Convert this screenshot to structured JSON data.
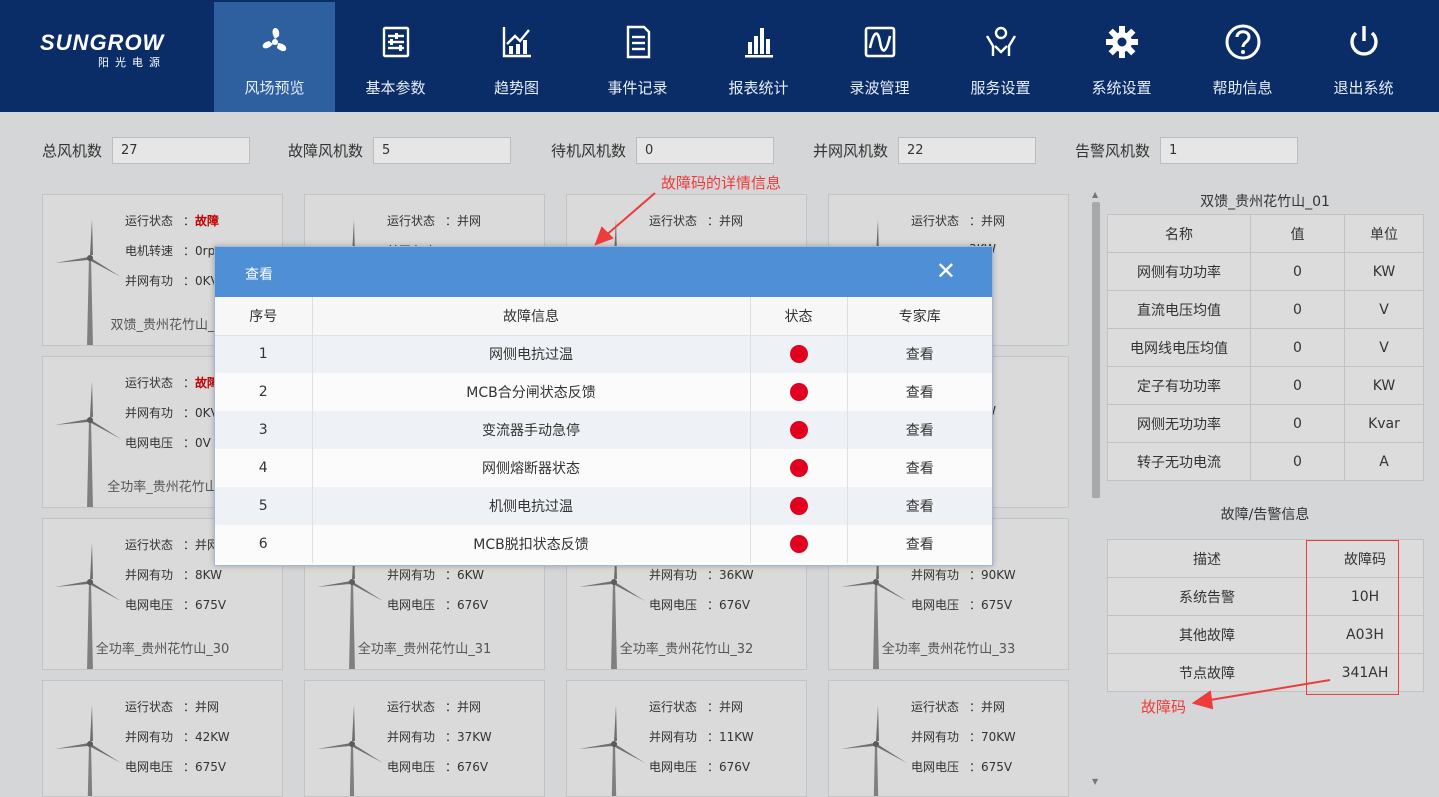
{
  "header": {
    "logo_brand": "SUNGROW",
    "logo_sub": "阳光电源",
    "nav": [
      {
        "label": "风场预览",
        "icon": "fan-icon",
        "active": true
      },
      {
        "label": "基本参数",
        "icon": "parameters-icon",
        "active": false
      },
      {
        "label": "趋势图",
        "icon": "trend-chart-icon",
        "active": false
      },
      {
        "label": "事件记录",
        "icon": "event-log-icon",
        "active": false
      },
      {
        "label": "报表统计",
        "icon": "report-bar-icon",
        "active": false
      },
      {
        "label": "录波管理",
        "icon": "waveform-icon",
        "active": false
      },
      {
        "label": "服务设置",
        "icon": "service-hands-icon",
        "active": false
      },
      {
        "label": "系统设置",
        "icon": "gear-icon",
        "active": false
      },
      {
        "label": "帮助信息",
        "icon": "help-icon",
        "active": false
      },
      {
        "label": "退出系统",
        "icon": "power-icon",
        "active": false
      }
    ]
  },
  "stats": [
    {
      "label": "总风机数",
      "value": "27"
    },
    {
      "label": "故障风机数",
      "value": "5"
    },
    {
      "label": "待机风机数",
      "value": "0"
    },
    {
      "label": "并网风机数",
      "value": "22"
    },
    {
      "label": "告警风机数",
      "value": "1"
    }
  ],
  "turbines": [
    {
      "rows": [
        {
          "k": "运行状态",
          "v": "故障",
          "fault": true
        },
        {
          "k": "电机转速",
          "v": "0rp"
        },
        {
          "k": "并网有功",
          "v": "0KV"
        }
      ],
      "name": "双馈_贵州花竹山_"
    },
    {
      "rows": [
        {
          "k": "运行状态",
          "v": "并网"
        },
        {
          "k": "并网有功",
          "v": ""
        },
        {
          "k": "",
          "v": ""
        }
      ],
      "name": ""
    },
    {
      "rows": [
        {
          "k": "运行状态",
          "v": "并网"
        },
        {
          "k": "",
          "v": ""
        },
        {
          "k": "",
          "v": ""
        }
      ],
      "name": ""
    },
    {
      "rows": [
        {
          "k": "运行状态",
          "v": "并网"
        },
        {
          "k": "",
          "v": "3KW"
        },
        {
          "k": "",
          "v": "76V"
        }
      ],
      "name": "山_25"
    },
    {
      "rows": [
        {
          "k": "运行状态",
          "v": "故障",
          "fault": true
        },
        {
          "k": "并网有功",
          "v": "0KV"
        },
        {
          "k": "电网电压",
          "v": "0V"
        }
      ],
      "name": "全功率_贵州花竹山"
    },
    {
      "rows": [],
      "name": ""
    },
    {
      "rows": [],
      "name": ""
    },
    {
      "rows": [
        {
          "k": "",
          "v": "网"
        },
        {
          "k": "",
          "v": "1KW"
        },
        {
          "k": "",
          "v": "75V"
        }
      ],
      "name": "山_29"
    },
    {
      "rows": [
        {
          "k": "运行状态",
          "v": "并网"
        },
        {
          "k": "并网有功",
          "v": "8KW"
        },
        {
          "k": "电网电压",
          "v": "675V"
        }
      ],
      "name": "全功率_贵州花竹山_30"
    },
    {
      "rows": [
        {
          "k": "",
          "v": ""
        },
        {
          "k": "并网有功",
          "v": "6KW"
        },
        {
          "k": "电网电压",
          "v": "676V"
        }
      ],
      "name": "全功率_贵州花竹山_31"
    },
    {
      "rows": [
        {
          "k": "",
          "v": ""
        },
        {
          "k": "并网有功",
          "v": "36KW"
        },
        {
          "k": "电网电压",
          "v": "676V"
        }
      ],
      "name": "全功率_贵州花竹山_32"
    },
    {
      "rows": [
        {
          "k": "",
          "v": "网"
        },
        {
          "k": "并网有功",
          "v": "90KW"
        },
        {
          "k": "电网电压",
          "v": "675V"
        }
      ],
      "name": "全功率_贵州花竹山_33"
    },
    {
      "rows": [
        {
          "k": "运行状态",
          "v": "并网"
        },
        {
          "k": "并网有功",
          "v": "42KW"
        },
        {
          "k": "电网电压",
          "v": "675V"
        }
      ],
      "name": ""
    },
    {
      "rows": [
        {
          "k": "运行状态",
          "v": "并网"
        },
        {
          "k": "并网有功",
          "v": "37KW"
        },
        {
          "k": "电网电压",
          "v": "676V"
        }
      ],
      "name": ""
    },
    {
      "rows": [
        {
          "k": "运行状态",
          "v": "并网"
        },
        {
          "k": "并网有功",
          "v": "11KW"
        },
        {
          "k": "电网电压",
          "v": "676V"
        }
      ],
      "name": ""
    },
    {
      "rows": [
        {
          "k": "运行状态",
          "v": "并网"
        },
        {
          "k": "并网有功",
          "v": "70KW"
        },
        {
          "k": "电网电压",
          "v": "675V"
        }
      ],
      "name": ""
    }
  ],
  "right_panel": {
    "title": "双馈_贵州花竹山_01",
    "params_headers": [
      "名称",
      "值",
      "单位"
    ],
    "params": [
      [
        "网侧有功功率",
        "0",
        "KW"
      ],
      [
        "直流电压均值",
        "0",
        "V"
      ],
      [
        "电网线电压均值",
        "0",
        "V"
      ],
      [
        "定子有功功率",
        "0",
        "KW"
      ],
      [
        "网侧无功功率",
        "0",
        "Kvar"
      ],
      [
        "转子无功电流",
        "0",
        "A"
      ]
    ],
    "fault_title": "故障/告警信息",
    "fault_headers": [
      "描述",
      "故障码"
    ],
    "faults": [
      [
        "系统告警",
        "10H"
      ],
      [
        "其他故障",
        "A03H"
      ],
      [
        "节点故障",
        "341AH"
      ]
    ]
  },
  "modal": {
    "title": "查看",
    "close": "✕",
    "headers": [
      "序号",
      "故障信息",
      "状态",
      "专家库"
    ],
    "rows": [
      {
        "no": "1",
        "info": "网侧电抗过温",
        "action": "查看"
      },
      {
        "no": "2",
        "info": "MCB合分闸状态反馈",
        "action": "查看"
      },
      {
        "no": "3",
        "info": "变流器手动急停",
        "action": "查看"
      },
      {
        "no": "4",
        "info": "网侧熔断器状态",
        "action": "查看"
      },
      {
        "no": "5",
        "info": "机侧电抗过温",
        "action": "查看"
      },
      {
        "no": "6",
        "info": "MCB脱扣状态反馈",
        "action": "查看"
      }
    ],
    "status_color": "#e1001f"
  },
  "annotations": {
    "detail": "故障码的详情信息",
    "code": "故障码",
    "color": "#ee3b3b"
  }
}
